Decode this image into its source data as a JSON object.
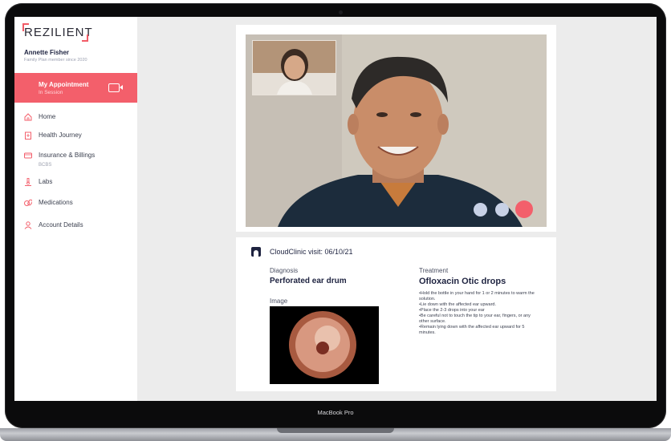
{
  "device": {
    "label": "MacBook Pro"
  },
  "brand": {
    "logo_text": "REZILIENT",
    "accent_color": "#f35f6b"
  },
  "user": {
    "name": "Annette Fisher",
    "subtitle": "Family Plan member since 2020"
  },
  "appointment": {
    "title": "My Appointment",
    "status": "In Session",
    "icon": "video-camera-icon"
  },
  "nav": [
    {
      "label": "Home",
      "icon": "home-icon"
    },
    {
      "label": "Health Journey",
      "icon": "clipboard-icon"
    },
    {
      "label": "Insurance & Billings",
      "sub": "BCBS",
      "icon": "card-icon"
    },
    {
      "label": "Labs",
      "icon": "microscope-icon"
    },
    {
      "label": "Medications",
      "icon": "pills-icon"
    },
    {
      "label": "Account Details",
      "icon": "person-icon"
    }
  ],
  "video": {
    "controls": [
      {
        "name": "mute",
        "color": "#c7d1e6"
      },
      {
        "name": "camera",
        "color": "#c7d1e6"
      },
      {
        "name": "end-call",
        "color": "#f35f6b"
      }
    ]
  },
  "visit": {
    "title": "CloudClinic visit: 06/10/21",
    "diagnosis_label": "Diagnosis",
    "diagnosis": "Perforated ear drum",
    "image_label": "Image",
    "treatment_label": "Treatment",
    "treatment": "Ofloxacin Otic drops",
    "instructions": [
      "•Hold the bottle in your hand for 1 or 2 minutes to warm the solution.",
      "•Lie down with the affected ear upward.",
      "•Place the 2-3 drops into your ear",
      "•Be careful not to touch the tip to your ear, fingers, or any other surface.",
      "•Remain lying down with the affected ear upward for 5 minutes."
    ]
  }
}
